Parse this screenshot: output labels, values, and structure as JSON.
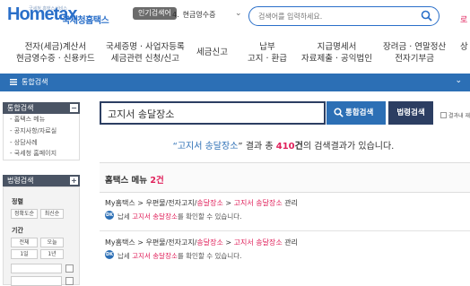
{
  "header": {
    "logo_main": "Hometax",
    "logo_tagline": "국세청 홈택스서비스",
    "logo_org": "국세청홈택스",
    "popular_badge": "인기검색어",
    "popular_rank": "4.",
    "popular_term": "현금영수증",
    "search_placeholder": "검색어를 입력하세요.",
    "corner_text": "로"
  },
  "topnav": [
    {
      "line1": "전자(세금)계산서",
      "line2": "현금영수증 · 신용카드"
    },
    {
      "line1": "국세증명 · 사업자등록",
      "line2": "세금관련 신청/신고"
    },
    {
      "line1": "세금신고",
      "line2": ""
    },
    {
      "line1": "납부",
      "line2": "고지 · 환급"
    },
    {
      "line1": "지급명세서",
      "line2": "자료제출 · 공익법인"
    },
    {
      "line1": "장려금 · 연말정산",
      "line2": "전자기부금"
    },
    {
      "line1": "상",
      "line2": ""
    }
  ],
  "bluebar": {
    "label": "통합검색",
    "menu_icon": "menu-icon"
  },
  "sidebar": {
    "section1_title": "통합검색",
    "section1_items": [
      "- 홈택스 메뉴",
      "- 공지사항/자료실",
      "- 상담사례",
      "- 국세청 홈페이지"
    ],
    "section2_title": "법령검색",
    "sort_title": "정렬",
    "sort_buttons": [
      "정확도순",
      "최신순"
    ],
    "period_title": "기간",
    "period_buttons": [
      "전체",
      "오늘",
      "1일",
      "1년"
    ]
  },
  "search": {
    "query": "고지서 송달장소",
    "total_button": "통합검색",
    "law_button": "법령검색",
    "within_label": "결과내 재검색"
  },
  "results_summary": {
    "prefix": "“",
    "query": "고지서 송달장소",
    "suffix_open": "” 결과 총 ",
    "count": "410",
    "count_unit": "건",
    "tail": "의 검색결과가 있습니다."
  },
  "section": {
    "title": "홈택스 메뉴 ",
    "count": "2건"
  },
  "results": [
    {
      "path_pre": "My홈택스 > 우편물/전자고지/",
      "path_hl1": "송달장소",
      "path_mid": " > ",
      "path_hl2": "고지서 송달장소",
      "path_post": " 관리",
      "icon_label": "DK",
      "desc_pre": "납세 ",
      "desc_hl": "고지서 송달장소",
      "desc_post": "를 확인할 수 있습니다."
    },
    {
      "path_pre": "My홈택스 > 우편물/전자고지/",
      "path_hl1": "송달장소",
      "path_mid": " > ",
      "path_hl2": "고지서 송달장소",
      "path_post": " 관리",
      "icon_label": "DK",
      "desc_pre": "납세 ",
      "desc_hl": "고지서 송달장소",
      "desc_post": "를 확인할 수 있습니다."
    }
  ],
  "colors": {
    "brand_blue": "#2c6fb5",
    "navy": "#2c3e62",
    "highlight": "#e0215b"
  }
}
